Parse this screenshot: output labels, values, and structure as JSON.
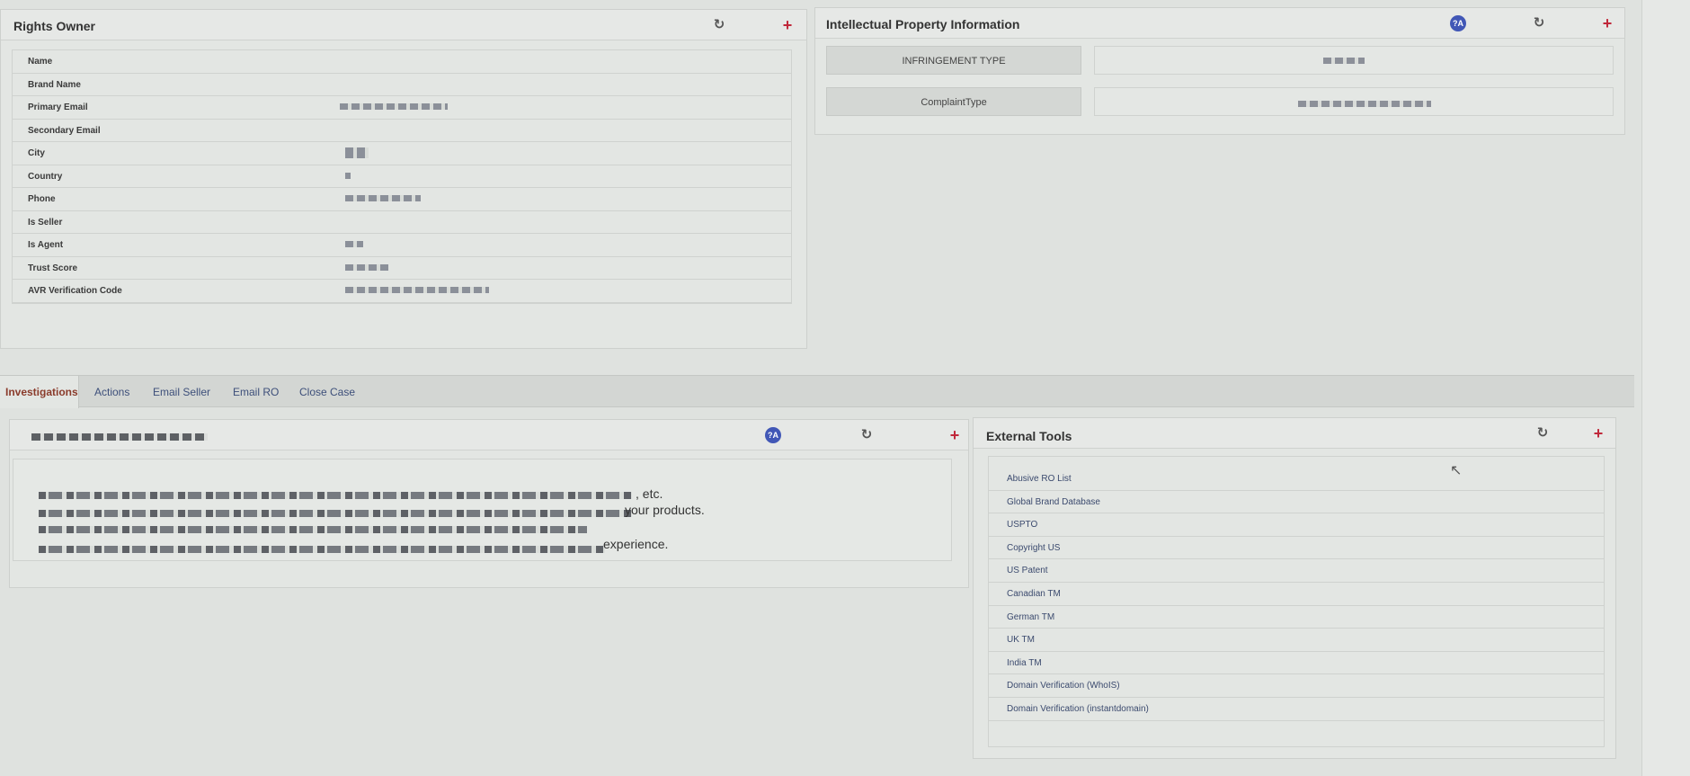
{
  "rights_owner": {
    "title": "Rights Owner",
    "fields": [
      {
        "label": "Name"
      },
      {
        "label": "Brand Name"
      },
      {
        "label": "Primary Email"
      },
      {
        "label": "Secondary Email"
      },
      {
        "label": "City"
      },
      {
        "label": "Country"
      },
      {
        "label": "Phone"
      },
      {
        "label": "Is Seller"
      },
      {
        "label": "Is Agent"
      },
      {
        "label": "Trust Score"
      },
      {
        "label": "AVR Verification Code"
      }
    ]
  },
  "ip_info": {
    "title": "Intellectual Property Information",
    "rows": [
      {
        "label": "INFRINGEMENT TYPE"
      },
      {
        "label": "ComplaintType"
      }
    ]
  },
  "tabs": [
    {
      "label": "Investigations",
      "active": true
    },
    {
      "label": "Actions",
      "active": false
    },
    {
      "label": "Email Seller",
      "active": false
    },
    {
      "label": "Email RO",
      "active": false
    },
    {
      "label": "Close Case",
      "active": false
    }
  ],
  "investigation": {
    "text_fragments": ", etc.",
    "text_fragment_2": "your products.",
    "text_fragment_3": "experience."
  },
  "external_tools": {
    "title": "External Tools",
    "items": [
      "Abusive RO List",
      "Global Brand Database",
      "USPTO",
      "Copyright US",
      "US Patent",
      "Canadian TM",
      "German TM",
      "UK TM",
      "India TM",
      "Domain Verification (WhoIS)",
      "Domain Verification (instantdomain)"
    ]
  },
  "icons": {
    "refresh": "refresh-icon",
    "add": "plus-icon",
    "help": "help-icon"
  },
  "colors": {
    "accent_red": "#c0283a",
    "link_blue": "#3d4f7a",
    "active_tab": "#8a3b2b"
  }
}
